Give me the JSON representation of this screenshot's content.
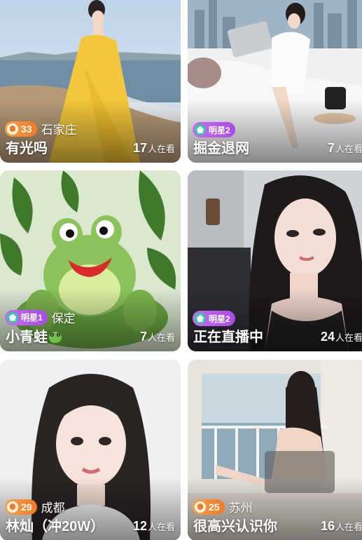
{
  "cards": [
    {
      "title": "有光吗",
      "city": "石家庄",
      "level": "33",
      "viewers": "17",
      "viewers_unit": "人在看"
    },
    {
      "title": "掘金退网",
      "city": "",
      "level": "明星2",
      "viewers": "7",
      "viewers_unit": "人在看"
    },
    {
      "title": "小青蛙",
      "city": "保定",
      "level": "明星1",
      "viewers": "7",
      "viewers_unit": "人在看"
    },
    {
      "title": "正在直播中",
      "city": "",
      "level": "明星2",
      "viewers": "24",
      "viewers_unit": "人在看"
    },
    {
      "title": "林灿（冲20W）",
      "city": "成都",
      "level": "29",
      "viewers": "12",
      "viewers_unit": "人在看"
    },
    {
      "title": "很高兴认识你",
      "city": "苏州",
      "level": "25",
      "viewers": "16",
      "viewers_unit": "人在看"
    }
  ],
  "colors": {
    "badge_orange": "#ef7a2a",
    "badge_purple": "#a84be6",
    "star_icon_green": "#35c9a2"
  },
  "icons": {
    "level_badge": "hexagon-level-icon",
    "star_badge": "star-level-icon",
    "title_emoji_card3": "frog-emoji-icon"
  }
}
